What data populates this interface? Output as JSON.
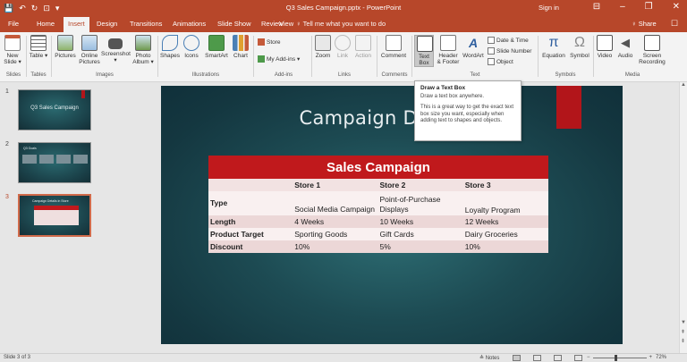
{
  "window": {
    "title": "Q3 Sales Campaign.pptx - PowerPoint",
    "signin": "Sign in",
    "minimize": "–",
    "restore": "❐",
    "close": "✕",
    "restore_ribbon": "⊟"
  },
  "qat": {
    "save_icon": "💾",
    "undo_icon": "↶",
    "redo_icon": "↻",
    "start_icon": "⊡",
    "customize_icon": "▾"
  },
  "tabs": {
    "file": "File",
    "home": "Home",
    "insert": "Insert",
    "design": "Design",
    "transitions": "Transitions",
    "animations": "Animations",
    "slideshow": "Slide Show",
    "review": "Review",
    "view": "View",
    "tellme": "♀ Tell me what you want to do",
    "share": "♀ Share",
    "comments_icon": "☐"
  },
  "ribbon": {
    "new_slide": "New Slide ▾",
    "table": "Table ▾",
    "pictures": "Pictures",
    "online_pictures": "Online Pictures",
    "screenshot": "Screenshot ▾",
    "photo_album": "Photo Album ▾",
    "shapes": "Shapes",
    "icons": "Icons",
    "smartart": "SmartArt",
    "chart": "Chart",
    "store": "Store",
    "my_addins": "My Add-ins ▾",
    "zoom": "Zoom",
    "link": "Link",
    "action": "Action",
    "comment": "Comment",
    "text_box": "Text Box",
    "header_footer": "Header & Footer",
    "wordart": "WordArt",
    "date_time": "Date & Time",
    "slide_number": "Slide Number",
    "object": "Object",
    "equation": "Equation",
    "symbol": "Symbol",
    "video": "Video",
    "audio": "Audio",
    "screen_recording": "Screen Recording",
    "groups": {
      "slides": "Slides",
      "tables": "Tables",
      "images": "Images",
      "illustrations": "Illustrations",
      "addins": "Add-ins",
      "links": "Links",
      "comments": "Comments",
      "text": "Text",
      "symbols": "Symbols",
      "media": "Media"
    },
    "accent": "#b7472a"
  },
  "tooltip": {
    "title": "Draw a Text Box",
    "subtitle": "Draw a text box anywhere.",
    "body": "This is a great way to get the exact text box size you want, especially when adding text to shapes and objects."
  },
  "thumbnails": [
    {
      "number": "1",
      "title": "Q3 Sales Campaign"
    },
    {
      "number": "2",
      "title": "Q3 Goals"
    },
    {
      "number": "3",
      "title": "Campaign Details in Store"
    }
  ],
  "slide": {
    "title": "Campaign Details",
    "table_header": "Sales Campaign",
    "columns": [
      "",
      "Store 1",
      "Store 2",
      "Store 3"
    ],
    "rows": [
      [
        "Type",
        "Social Media Campaign",
        "Point-of-Purchase Displays",
        "Loyalty Program"
      ],
      [
        "Length",
        "4 Weeks",
        "10 Weeks",
        "12 Weeks"
      ],
      [
        "Product Target",
        "Sporting Goods",
        "Gift Cards",
        "Dairy Groceries"
      ],
      [
        "Discount",
        "10%",
        "5%",
        "10%"
      ]
    ],
    "header_color": "#c0191c",
    "bg_color": "#1d4b53"
  },
  "status": {
    "slide_of": "Slide 3 of 3",
    "notes": "≜ Notes",
    "zoom_minus": "−",
    "zoom_plus": "+",
    "zoom_level": "72%"
  }
}
